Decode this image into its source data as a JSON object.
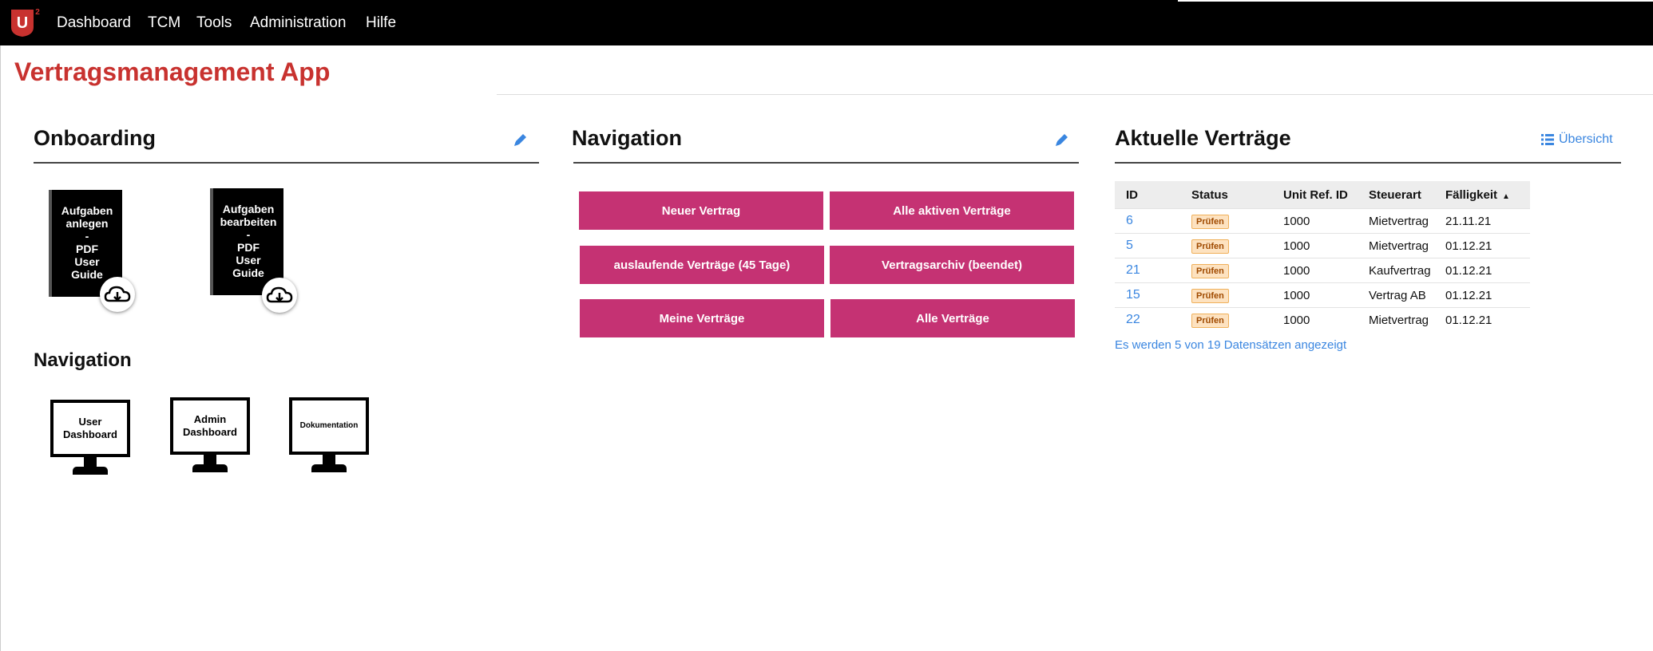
{
  "brand": {
    "logo_letter": "U",
    "logo_superscript": "2",
    "accent": "#c8322f"
  },
  "topnav": [
    {
      "label": "Dashboard"
    },
    {
      "label": "TCM"
    },
    {
      "label": "Tools"
    },
    {
      "label": "Administration"
    },
    {
      "label": "Hilfe"
    }
  ],
  "page": {
    "title": "Vertragsmanagement App"
  },
  "onboarding": {
    "title": "Onboarding",
    "edit_icon": "pencil-icon",
    "guides": [
      {
        "line1": "Aufgaben",
        "line2": "anlegen",
        "dash": "-",
        "line3": "PDF",
        "line4": "User",
        "line5": "Guide",
        "icon": "cloud-download-icon"
      },
      {
        "line1": "Aufgaben",
        "line2": "bearbeiten",
        "dash": "-",
        "line3": "PDF",
        "line4": "User",
        "line5": "Guide",
        "icon": "cloud-download-icon"
      }
    ],
    "nav_title": "Navigation",
    "dashboards": [
      {
        "line1": "User",
        "line2": "Dashboard"
      },
      {
        "line1": "Admin",
        "line2": "Dashboard"
      },
      {
        "line1": "Dokumentation",
        "line2": ""
      }
    ]
  },
  "navigation": {
    "title": "Navigation",
    "edit_icon": "pencil-icon",
    "color": "#c53273",
    "buttons": [
      {
        "label": "Neuer Vertrag"
      },
      {
        "label": "Alle aktiven Verträge"
      },
      {
        "label": "auslaufende Verträge (45 Tage)"
      },
      {
        "label": "Vertragsarchiv (beendet)"
      },
      {
        "label": "Meine Verträge"
      },
      {
        "label": "Alle Verträge"
      }
    ]
  },
  "contracts": {
    "title": "Aktuelle Verträge",
    "overview_label": "Übersicht",
    "overview_icon": "list-icon",
    "columns": [
      "ID",
      "Status",
      "Unit Ref. ID",
      "Steuerart",
      "Fälligkeit"
    ],
    "sort_icon": "sort-asc-icon",
    "rows": [
      {
        "id": "6",
        "status": "Prüfen",
        "unit": "1000",
        "tax": "Mietvertrag",
        "due": "21.11.21"
      },
      {
        "id": "5",
        "status": "Prüfen",
        "unit": "1000",
        "tax": "Mietvertrag",
        "due": "01.12.21"
      },
      {
        "id": "21",
        "status": "Prüfen",
        "unit": "1000",
        "tax": "Kaufvertrag",
        "due": "01.12.21"
      },
      {
        "id": "15",
        "status": "Prüfen",
        "unit": "1000",
        "tax": "Vertrag AB",
        "due": "01.12.21"
      },
      {
        "id": "22",
        "status": "Prüfen",
        "unit": "1000",
        "tax": "Mietvertrag",
        "due": "01.12.21"
      }
    ],
    "footer": "Es werden 5 von 19 Datensätzen angezeigt"
  }
}
